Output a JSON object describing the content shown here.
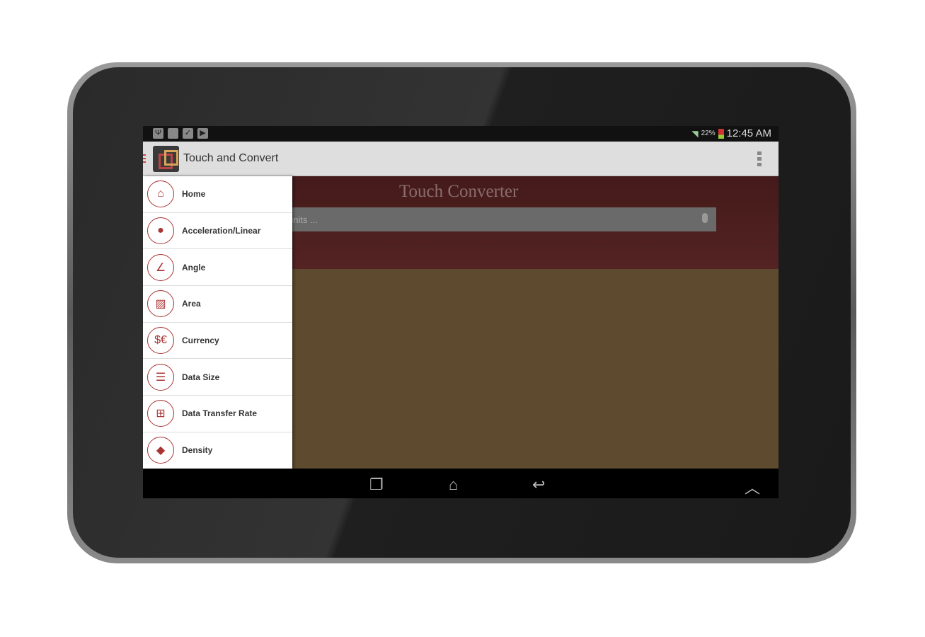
{
  "status_bar": {
    "icons": [
      "usb-icon",
      "image-icon",
      "clipboard-icon",
      "play-store-icon"
    ],
    "battery": "22%",
    "time": "12:45 AM"
  },
  "action_bar": {
    "title": "Touch and Convert"
  },
  "main": {
    "title": "Touch Converter",
    "search_placeholder": "units ..."
  },
  "drawer": {
    "items": [
      {
        "label": "Home",
        "icon": "home-icon",
        "glyph": "⌂"
      },
      {
        "label": "Acceleration/Linear",
        "icon": "acceleration-icon",
        "glyph": "●"
      },
      {
        "label": "Angle",
        "icon": "angle-icon",
        "glyph": "∠"
      },
      {
        "label": "Area",
        "icon": "area-icon",
        "glyph": "▨"
      },
      {
        "label": "Currency",
        "icon": "currency-icon",
        "glyph": "$€"
      },
      {
        "label": "Data Size",
        "icon": "database-icon",
        "glyph": "☰"
      },
      {
        "label": "Data Transfer Rate",
        "icon": "data-transfer-icon",
        "glyph": "⊞"
      },
      {
        "label": "Density",
        "icon": "diamond-icon",
        "glyph": "◆"
      }
    ]
  },
  "colors": {
    "accent": "#a33333",
    "header": "#4a1e1e",
    "background": "#5e4b2f"
  }
}
